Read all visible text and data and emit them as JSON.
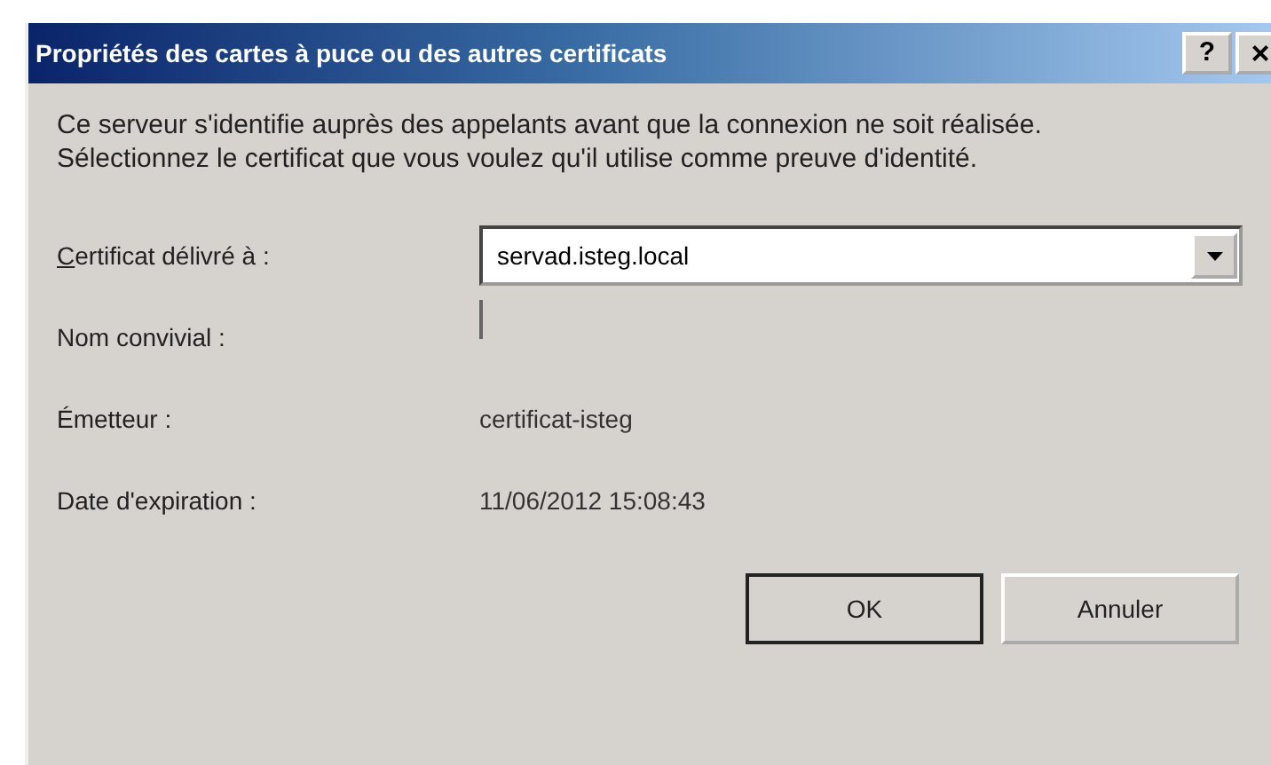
{
  "window": {
    "title": "Propriétés des cartes à puce ou des autres certificats",
    "title_buttons": [
      {
        "kind": "help",
        "label": "?"
      },
      {
        "kind": "close",
        "label": "×"
      }
    ]
  },
  "description": "Ce serveur s'identifie auprès des appelants avant que la connexion ne soit réalisée. Sélectionnez le certificat que vous voulez qu'il utilise comme preuve d'identité.",
  "fields": [
    {
      "kind": "combo",
      "label": "Certificat délivré à :",
      "mnemonic": true,
      "value": "servad.isteg.local"
    },
    {
      "kind": "cursor",
      "label": "Nom convivial :",
      "mnemonic": false
    },
    {
      "kind": "text",
      "label": "Émetteur :",
      "mnemonic": false,
      "value": "certificat-isteg"
    },
    {
      "kind": "text",
      "label": "Date d'expiration :",
      "mnemonic": false,
      "value": "11/06/2012 15:08:43"
    }
  ],
  "buttons": [
    {
      "label": "OK",
      "default": true
    },
    {
      "label": "Annuler",
      "default": false
    }
  ]
}
